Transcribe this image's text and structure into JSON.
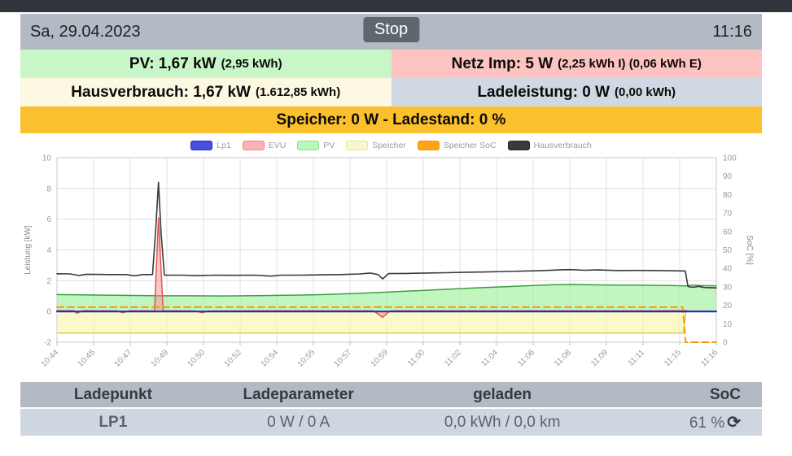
{
  "header": {
    "date": "Sa, 29.04.2023",
    "stop_label": "Stop",
    "time": "11:16"
  },
  "tiles": {
    "pv": {
      "main": "PV: 1,67 kW",
      "sub": "(2,95 kWh)"
    },
    "grid": {
      "main": "Netz Imp: 5 W",
      "sub": "(2,25 kWh I) (0,06 kWh E)"
    },
    "house": {
      "main": "Hausverbrauch: 1,67 kW",
      "sub": "(1.612,85 kWh)"
    },
    "charge": {
      "main": "Ladeleistung: 0 W",
      "sub": "(0,00 kWh)"
    },
    "battery": {
      "main": "Speicher: 0 W - Ladestand: 0 %"
    }
  },
  "colors": {
    "topbar": "#2f353b",
    "header_bar": "#b3bac4",
    "stop_button": "#5f666d",
    "tile_pv": "#c9f6c9",
    "tile_grid": "#fcc3c1",
    "tile_house": "#fcf8e1",
    "tile_charge": "#cfd8e3",
    "tile_battery": "#fbc02d",
    "table_header": "#b3bac4",
    "table_row": "#ced7e0",
    "lp1_green": "#0c7c0c"
  },
  "chart_data": {
    "type": "line",
    "xlabel": "",
    "ylabel_left": "Leistung [kW]",
    "ylabel_right": "SoC [%]",
    "ylim_left": [
      -2,
      10
    ],
    "yticks_left": [
      -2,
      0,
      2,
      4,
      6,
      8,
      10
    ],
    "ylim_right": [
      0,
      100
    ],
    "yticks_right": [
      0,
      10,
      20,
      30,
      40,
      50,
      60,
      70,
      80,
      90,
      100
    ],
    "grid": true,
    "legend_position": "top",
    "x_tick_labels": [
      "10:44",
      "10:45",
      "10:47",
      "10:49",
      "10:50",
      "10:52",
      "10:54",
      "10:55",
      "10:57",
      "10:59",
      "11:00",
      "11:02",
      "11:04",
      "11:06",
      "11:08",
      "11:09",
      "11:11",
      "11:15",
      "11:16"
    ],
    "legend": [
      {
        "label": "Lp1",
        "fill": "#4a4fe0",
        "border": "#2227cf",
        "dashed": false
      },
      {
        "label": "EVU",
        "fill": "#f9b3b6",
        "border": "#ef838a",
        "dashed": false
      },
      {
        "label": "PV",
        "fill": "#baf6ba",
        "border": "#86e286",
        "dashed": false
      },
      {
        "label": "Speicher",
        "fill": "#f8f8cd",
        "border": "#e4e48e",
        "dashed": false
      },
      {
        "label": "Speicher SoC",
        "fill": "#ffa216",
        "border": "#ff8a00",
        "dashed": true
      },
      {
        "label": "Hausverbrauch",
        "fill": "#3a3a3a",
        "border": "#2a2a2a",
        "dashed": false
      }
    ],
    "series": [
      {
        "name": "Speicher",
        "axis": "left",
        "color": "#ddd04a",
        "width": 1.5,
        "fill": "rgba(248,248,170,0.65)",
        "points": [
          [
            0,
            -1.4
          ],
          [
            0.95,
            -1.4
          ],
          [
            0.954,
            0
          ],
          [
            1,
            0
          ]
        ]
      },
      {
        "name": "PV",
        "axis": "left",
        "color": "#3d9e3d",
        "width": 1.5,
        "fill": "rgba(152,240,152,0.6)",
        "points": [
          [
            0,
            1.1
          ],
          [
            0.04,
            1.08
          ],
          [
            0.09,
            1.05
          ],
          [
            0.154,
            1.02
          ],
          [
            0.2,
            1.02
          ],
          [
            0.25,
            1.01
          ],
          [
            0.3,
            1.03
          ],
          [
            0.35,
            1.05
          ],
          [
            0.4,
            1.09
          ],
          [
            0.44,
            1.15
          ],
          [
            0.48,
            1.22
          ],
          [
            0.52,
            1.3
          ],
          [
            0.56,
            1.38
          ],
          [
            0.6,
            1.46
          ],
          [
            0.64,
            1.54
          ],
          [
            0.68,
            1.61
          ],
          [
            0.72,
            1.68
          ],
          [
            0.75,
            1.73
          ],
          [
            0.78,
            1.76
          ],
          [
            0.81,
            1.73
          ],
          [
            0.84,
            1.72
          ],
          [
            0.87,
            1.71
          ],
          [
            0.9,
            1.7
          ],
          [
            0.93,
            1.69
          ],
          [
            0.953,
            1.66
          ],
          [
            0.965,
            1.72
          ],
          [
            0.98,
            1.68
          ],
          [
            1,
            1.67
          ]
        ]
      },
      {
        "name": "EVU",
        "axis": "left",
        "color": "#e05555",
        "width": 1.5,
        "fill": "rgba(246,130,134,0.45)",
        "points": [
          [
            0,
            0.05
          ],
          [
            0.025,
            0.05
          ],
          [
            0.03,
            -0.12
          ],
          [
            0.04,
            0.05
          ],
          [
            0.09,
            0.04
          ],
          [
            0.1,
            -0.08
          ],
          [
            0.11,
            0.04
          ],
          [
            0.148,
            0.05
          ],
          [
            0.154,
            6.1
          ],
          [
            0.161,
            0.05
          ],
          [
            0.21,
            0.03
          ],
          [
            0.22,
            -0.08
          ],
          [
            0.23,
            0.03
          ],
          [
            0.3,
            0.04
          ],
          [
            0.4,
            0.04
          ],
          [
            0.48,
            0.04
          ],
          [
            0.494,
            -0.38
          ],
          [
            0.505,
            0.04
          ],
          [
            0.6,
            0.04
          ],
          [
            0.7,
            0.04
          ],
          [
            0.8,
            0.04
          ],
          [
            0.9,
            0.04
          ],
          [
            0.953,
            0.05
          ],
          [
            0.96,
            0.02
          ],
          [
            1,
            0.01
          ]
        ]
      },
      {
        "name": "Speicher SoC",
        "axis": "right",
        "color": "#ff9800",
        "width": 2,
        "dash": "8 5",
        "points": [
          [
            0,
            19
          ],
          [
            0.949,
            19
          ],
          [
            0.9535,
            0
          ],
          [
            1,
            0
          ]
        ]
      },
      {
        "name": "Lp1",
        "axis": "left",
        "color": "#2323cc",
        "width": 2,
        "points": [
          [
            0,
            0
          ],
          [
            1,
            0
          ]
        ]
      },
      {
        "name": "Hausverbrauch",
        "axis": "left",
        "color": "#3a3a3a",
        "width": 1.6,
        "points": [
          [
            0,
            2.45
          ],
          [
            0.02,
            2.44
          ],
          [
            0.033,
            2.34
          ],
          [
            0.045,
            2.42
          ],
          [
            0.08,
            2.4
          ],
          [
            0.105,
            2.4
          ],
          [
            0.118,
            2.32
          ],
          [
            0.13,
            2.4
          ],
          [
            0.145,
            2.4
          ],
          [
            0.15,
            5.5
          ],
          [
            0.154,
            8.4
          ],
          [
            0.158,
            5.0
          ],
          [
            0.163,
            2.36
          ],
          [
            0.19,
            2.36
          ],
          [
            0.21,
            2.33
          ],
          [
            0.24,
            2.36
          ],
          [
            0.27,
            2.35
          ],
          [
            0.3,
            2.36
          ],
          [
            0.325,
            2.3
          ],
          [
            0.34,
            2.36
          ],
          [
            0.37,
            2.36
          ],
          [
            0.4,
            2.38
          ],
          [
            0.43,
            2.4
          ],
          [
            0.46,
            2.44
          ],
          [
            0.475,
            2.5
          ],
          [
            0.487,
            2.4
          ],
          [
            0.494,
            2.12
          ],
          [
            0.503,
            2.46
          ],
          [
            0.53,
            2.47
          ],
          [
            0.56,
            2.5
          ],
          [
            0.59,
            2.52
          ],
          [
            0.62,
            2.55
          ],
          [
            0.65,
            2.57
          ],
          [
            0.68,
            2.6
          ],
          [
            0.71,
            2.63
          ],
          [
            0.74,
            2.66
          ],
          [
            0.765,
            2.71
          ],
          [
            0.78,
            2.72
          ],
          [
            0.8,
            2.68
          ],
          [
            0.82,
            2.7
          ],
          [
            0.85,
            2.66
          ],
          [
            0.88,
            2.67
          ],
          [
            0.91,
            2.66
          ],
          [
            0.94,
            2.64
          ],
          [
            0.953,
            2.63
          ],
          [
            0.957,
            1.62
          ],
          [
            0.965,
            1.57
          ],
          [
            0.973,
            1.63
          ],
          [
            0.982,
            1.56
          ],
          [
            1,
            1.53
          ]
        ]
      }
    ]
  },
  "table": {
    "headers": [
      "Ladepunkt",
      "Ladeparameter",
      "geladen",
      "SoC"
    ],
    "row": {
      "ladepunkt": "LP1",
      "ladeparameter": "0 W / 0 A",
      "geladen": "0,0 kWh / 0,0 km",
      "soc": "61 %",
      "refresh_glyph": "⟳"
    }
  }
}
